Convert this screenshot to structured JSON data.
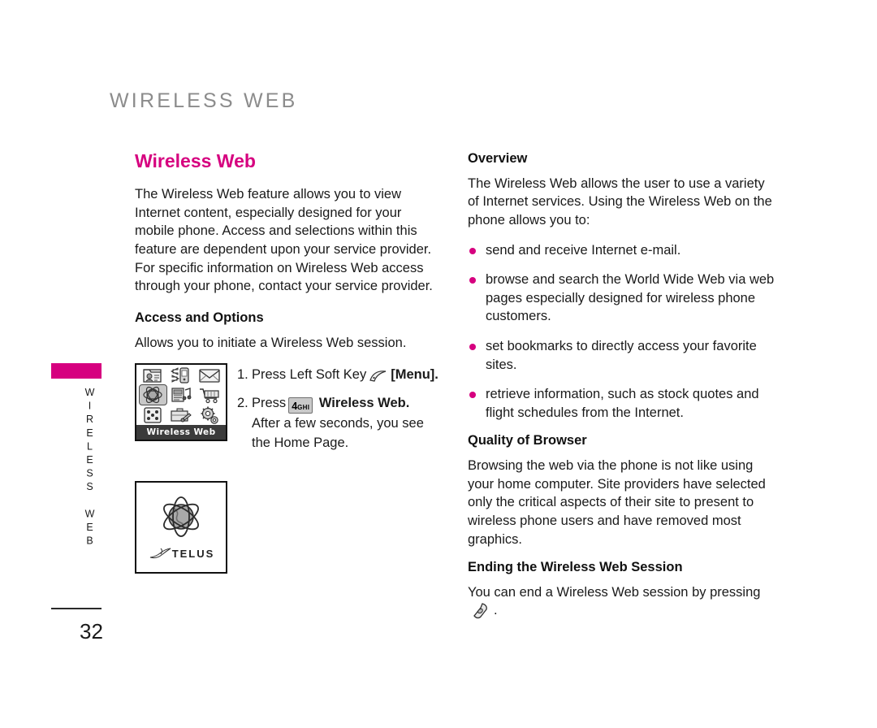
{
  "page": {
    "header": "WIRELESS WEB",
    "margin_tab_label": "WIRELESS WEB",
    "page_number": "32",
    "accent_color": "#d6007f",
    "header_color": "#8c8c8c"
  },
  "left_column": {
    "title": "Wireless Web",
    "intro": "The Wireless Web feature allows you to view Internet content,  especially designed for your mobile phone. Access and selections within this feature are dependent upon your service provider. For specific information on Wireless Web access through your phone, contact your service provider.",
    "access_heading": "Access and Options",
    "access_text": "Allows you to initiate a Wireless Web session.",
    "steps": [
      {
        "number": "1.",
        "prefix": "Press Left Soft Key",
        "icon": "left-soft-key-icon",
        "suffix": "[Menu].",
        "sub": ""
      },
      {
        "number": "2.",
        "prefix": "Press",
        "key_digit": "4",
        "key_letters": "GHI",
        "suffix": "Wireless Web.",
        "sub": "After a few seconds, you see the Home Page."
      }
    ],
    "phone_screenshot": {
      "label": "Wireless Web",
      "icons": [
        "contacts-icon",
        "bluetooth-sync-icon",
        "messaging-icon",
        "globe-web-icon",
        "media-music-icon",
        "shopping-cart-icon",
        "games-dice-icon",
        "tools-icon",
        "settings-gear-icon"
      ],
      "selected_index": 3
    },
    "telus_screenshot": {
      "brand": "TELUS",
      "graphic": "telus-globe-icon"
    }
  },
  "right_column": {
    "overview_heading": "Overview",
    "overview_text": "The Wireless Web allows the user to use a variety of Internet services. Using the Wireless Web on the phone allows you to:",
    "bullets": [
      "send and receive Internet e-mail.",
      "browse and search the World Wide Web via web pages especially designed for wireless phone customers.",
      "set bookmarks to directly access your favorite sites.",
      "retrieve information, such as stock quotes and flight schedules from the Internet."
    ],
    "quality_heading": "Quality of Browser",
    "quality_text": "Browsing the web via the phone is not like using your home computer. Site providers have selected only the critical aspects of their site to present to wireless phone users and have removed most graphics.",
    "ending_heading": "Ending the Wireless Web Session",
    "ending_prefix": "You can end a Wireless Web session by pressing",
    "ending_icon": "end-call-key-icon",
    "ending_suffix": "."
  }
}
